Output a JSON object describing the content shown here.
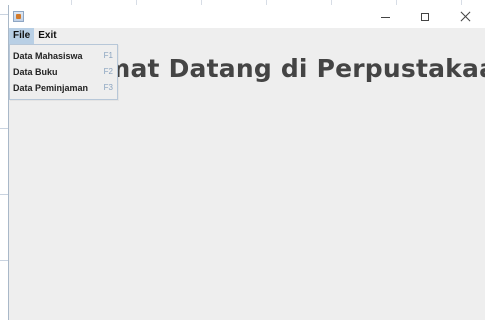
{
  "window": {
    "controls": {
      "minimize_icon": "minimize-icon",
      "maximize_icon": "maximize-icon",
      "close_icon": "close-icon"
    }
  },
  "menubar": {
    "items": [
      {
        "label": "File"
      },
      {
        "label": "Exit"
      }
    ]
  },
  "file_menu": {
    "items": [
      {
        "label": "Data Mahasiswa",
        "shortcut": "F1"
      },
      {
        "label": "Data Buku",
        "shortcut": "F2"
      },
      {
        "label": "Data Peminjaman",
        "shortcut": "F3"
      }
    ]
  },
  "main": {
    "title": "Selamat Datang di Perpustakaan"
  },
  "colors": {
    "window_background": "#eeeeee",
    "menu_highlight": "#b8cfe5",
    "title_text": "#444444",
    "shortcut_text": "#8aa3bf"
  }
}
